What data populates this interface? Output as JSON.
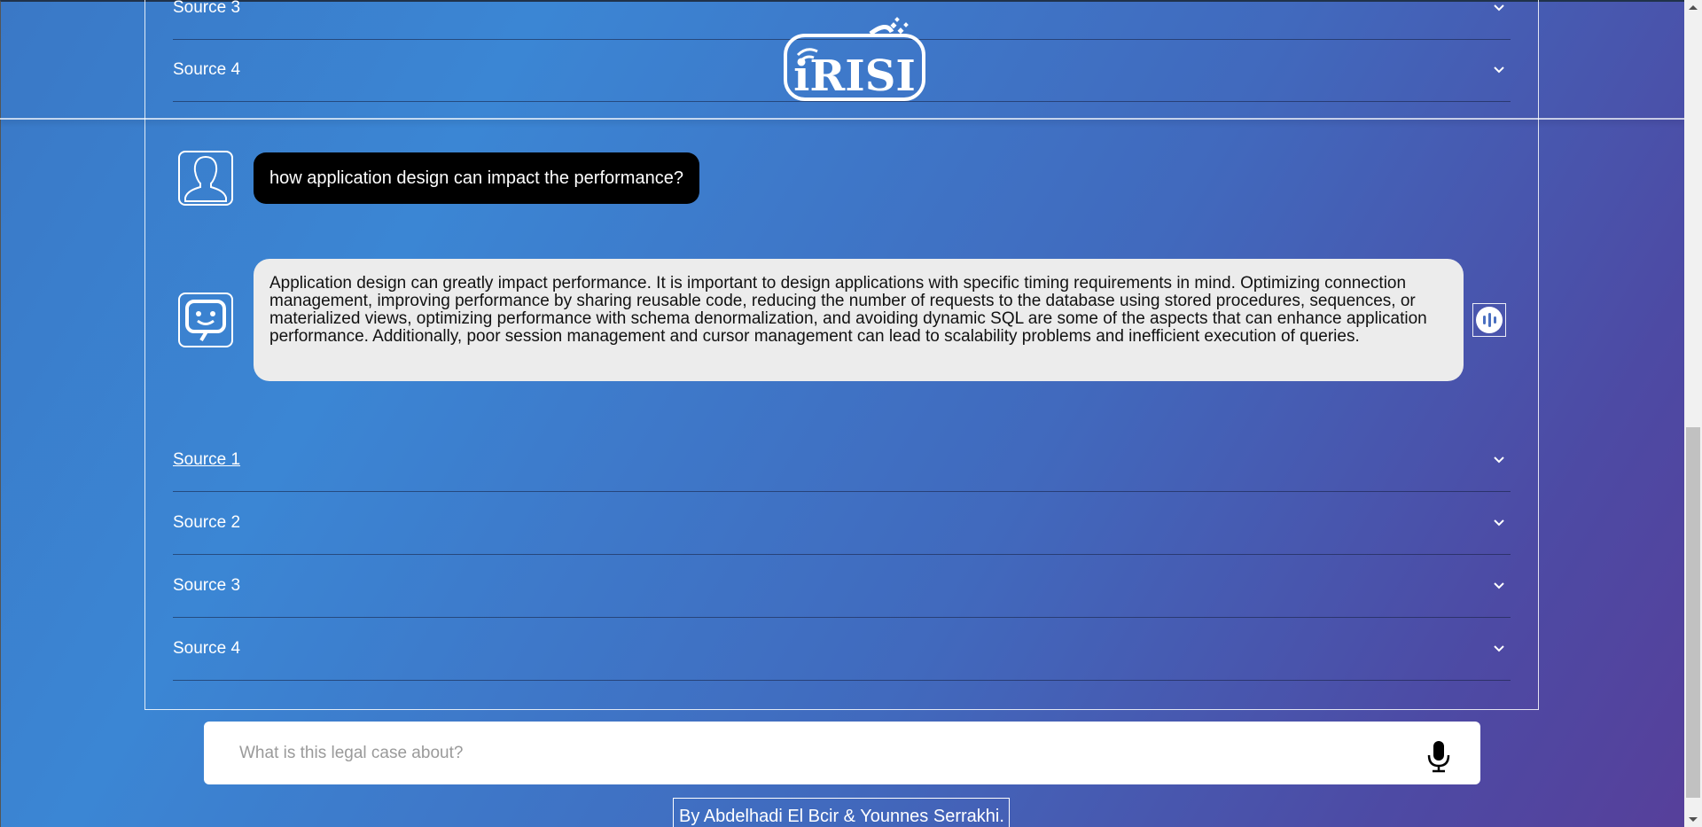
{
  "header": {
    "logo_text": "iRISI"
  },
  "top_sources": [
    {
      "label": "Source 3"
    },
    {
      "label": "Source 4"
    }
  ],
  "conversation": {
    "user_message": "how application design can impact the performance?",
    "bot_message": "Application design can greatly impact performance. It is important to design applications with specific timing requirements in mind. Optimizing connection management, improving performance by sharing reusable code, reducing the number of requests to the database using stored procedures, sequences, or materialized views, optimizing performance with schema denormalization, and avoiding dynamic SQL are some of the aspects that can enhance application performance. Additionally, poor session management and cursor management can lead to scalability problems and inefficient execution of queries."
  },
  "sources": [
    {
      "label": "Source 1"
    },
    {
      "label": "Source 2"
    },
    {
      "label": "Source 3"
    },
    {
      "label": "Source 4"
    }
  ],
  "input": {
    "placeholder": "What is this legal case about?",
    "value": ""
  },
  "footer": {
    "credit": "By Abdelhadi El Bcir & Younnes Serrakhi."
  },
  "icons": {
    "user_avatar": "user-silhouette-icon",
    "bot_avatar": "chatbot-face-icon",
    "speak": "audio-wave-icon",
    "mic": "microphone-icon",
    "chevron": "chevron-down-icon"
  },
  "colors": {
    "background_start": "#3b86d4",
    "background_end": "#573f9a",
    "user_bubble": "#000000",
    "bot_bubble": "#ececec"
  }
}
